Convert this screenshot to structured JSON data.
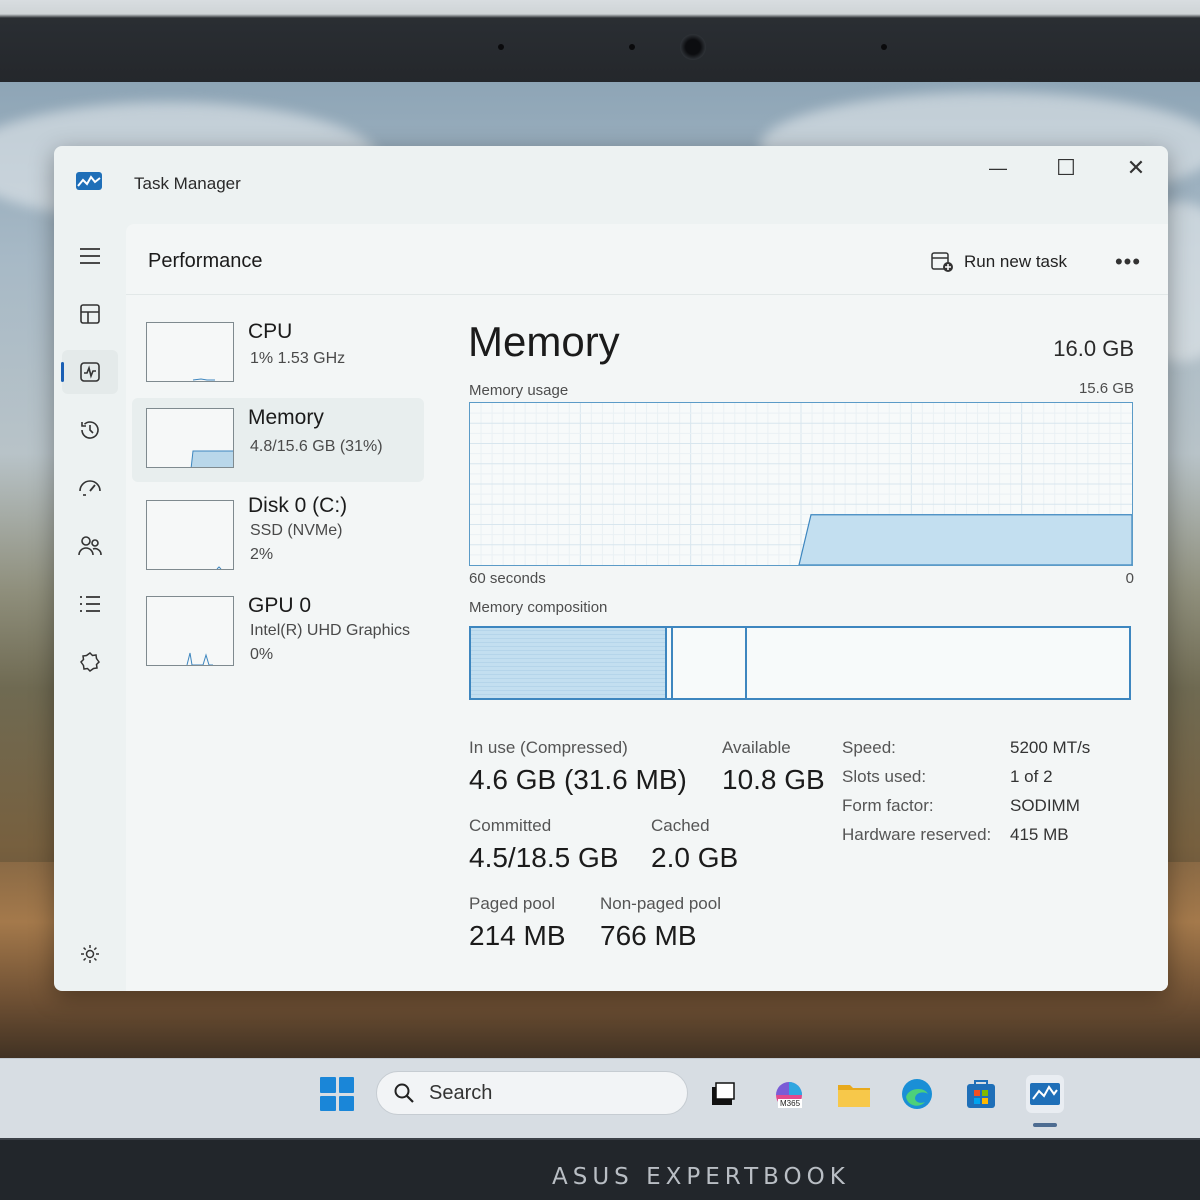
{
  "window": {
    "title": "Task Manager",
    "minimize_label": "—",
    "maximize_label": "☐",
    "close_label": "✕"
  },
  "sidebar": {
    "items": [
      {
        "icon": "hamburger-icon"
      },
      {
        "icon": "processes-icon"
      },
      {
        "icon": "performance-icon"
      },
      {
        "icon": "app-history-icon"
      },
      {
        "icon": "startup-apps-icon"
      },
      {
        "icon": "users-icon"
      },
      {
        "icon": "details-icon"
      },
      {
        "icon": "services-icon"
      },
      {
        "icon": "settings-icon"
      }
    ]
  },
  "header": {
    "page_title": "Performance",
    "run_new_task": "Run new task",
    "more": "•••"
  },
  "resources": [
    {
      "name": "CPU",
      "line1": "1%  1.53 GHz",
      "line2": ""
    },
    {
      "name": "Memory",
      "line1": "4.8/15.6 GB (31%)",
      "line2": ""
    },
    {
      "name": "Disk 0 (C:)",
      "line1": "SSD (NVMe)",
      "line2": "2%"
    },
    {
      "name": "GPU 0",
      "line1": "Intel(R) UHD Graphics",
      "line2": "0%"
    }
  ],
  "memory": {
    "title": "Memory",
    "total": "16.0 GB",
    "usage_label": "Memory usage",
    "usage_max": "15.6 GB",
    "axis_left": "60 seconds",
    "axis_right": "0",
    "composition_label": "Memory composition",
    "usage_fraction": 0.31,
    "composition": {
      "in_use_fraction": 0.295,
      "modified_fraction": 0.012,
      "standby_fraction": 0.113
    },
    "stats": {
      "in_use_label": "In use (Compressed)",
      "in_use_value": "4.6 GB (31.6 MB)",
      "available_label": "Available",
      "available_value": "10.8 GB",
      "committed_label": "Committed",
      "committed_value": "4.5/18.5 GB",
      "cached_label": "Cached",
      "cached_value": "2.0 GB",
      "paged_label": "Paged pool",
      "paged_value": "214 MB",
      "nonpaged_label": "Non-paged pool",
      "nonpaged_value": "766 MB"
    },
    "specs": [
      {
        "label": "Speed:",
        "value": "5200 MT/s"
      },
      {
        "label": "Slots used:",
        "value": "1 of 2"
      },
      {
        "label": "Form factor:",
        "value": "SODIMM"
      },
      {
        "label": "Hardware reserved:",
        "value": "415 MB"
      }
    ]
  },
  "taskbar": {
    "search_label": "Search",
    "m365_label": "M365"
  },
  "device": {
    "brand": "ASUS EXPERTBOOK"
  },
  "colors": {
    "accent": "#1a5fb4",
    "memory_fill": "#c3dff0",
    "memory_line": "#3d86bf"
  }
}
